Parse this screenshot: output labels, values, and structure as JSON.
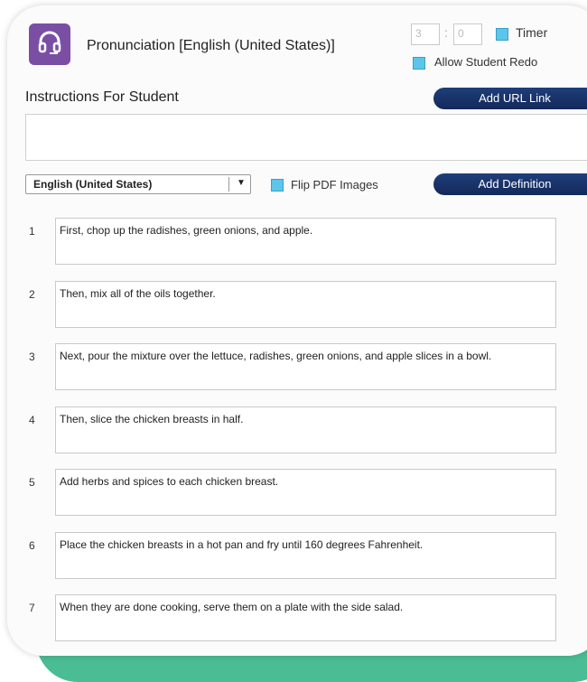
{
  "header": {
    "title": "Pronunciation [English (United States)]",
    "timer_minutes": "3",
    "timer_seconds": "0",
    "timer_separator": ":",
    "timer_label": "Timer",
    "allow_redo_label": "Allow Student Redo"
  },
  "instructions": {
    "label": "Instructions For Student",
    "add_url_label": "Add URL Link",
    "value": ""
  },
  "language": {
    "selected": "English (United States)",
    "flip_pdf_label": "Flip PDF Images",
    "add_definition_label": "Add Definition"
  },
  "rows": [
    {
      "num": "1",
      "text": "First, chop up the radishes, green onions, and apple."
    },
    {
      "num": "2",
      "text": "Then, mix all of the oils together."
    },
    {
      "num": "3",
      "text": "Next, pour the mixture over the lettuce, radishes, green onions, and apple slices in a bowl."
    },
    {
      "num": "4",
      "text": "Then, slice the chicken breasts in half."
    },
    {
      "num": "5",
      "text": "Add herbs and spices to each chicken breast."
    },
    {
      "num": "6",
      "text": "Place the chicken breasts in a hot pan and fry until 160 degrees Fahrenheit."
    },
    {
      "num": "7",
      "text": "When they are done cooking, serve them on a plate with the side salad."
    }
  ],
  "icons": {
    "headset": "headset-icon",
    "dropdown": "chevron-down-icon"
  },
  "colors": {
    "accent": "#4bbd94",
    "icon_tile": "#7a4fa3",
    "checkbox": "#5bc6ea",
    "button": "#1a3468"
  }
}
